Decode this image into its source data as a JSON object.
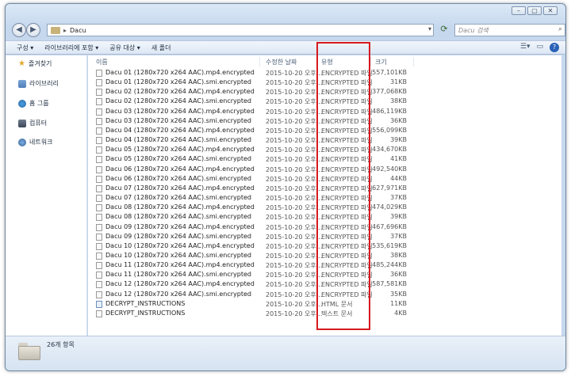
{
  "address": {
    "path": "Dacu"
  },
  "search": {
    "placeholder": "Dacu 검색"
  },
  "toolbar": {
    "items": [
      "구성 ▾",
      "라이브러리에 포함 ▾",
      "공유 대상 ▾",
      "새 폴더"
    ]
  },
  "navpane": {
    "items": [
      "즐겨찾기",
      "라이브러리",
      "홈 그룹",
      "컴퓨터",
      "네트워크"
    ]
  },
  "columns": {
    "name": "이름",
    "date": "수정한 날짜",
    "type": "유형",
    "size": "크기"
  },
  "files": [
    {
      "name": "Dacu 01 (1280x720 x264 AAC).mp4.encrypted",
      "date": "2015-10-20 오후...",
      "type": "ENCRYPTED 파일",
      "size": "557,101KB"
    },
    {
      "name": "Dacu 01 (1280x720 x264 AAC).smi.encrypted",
      "date": "2015-10-20 오후...",
      "type": "ENCRYPTED 파일",
      "size": "31KB"
    },
    {
      "name": "Dacu 02 (1280x720 x264 AAC).mp4.encrypted",
      "date": "2015-10-20 오후...",
      "type": "ENCRYPTED 파일",
      "size": "377,068KB"
    },
    {
      "name": "Dacu 02 (1280x720 x264 AAC).smi.encrypted",
      "date": "2015-10-20 오후...",
      "type": "ENCRYPTED 파일",
      "size": "38KB"
    },
    {
      "name": "Dacu 03 (1280x720 x264 AAC).mp4.encrypted",
      "date": "2015-10-20 오후...",
      "type": "ENCRYPTED 파일",
      "size": "486,119KB"
    },
    {
      "name": "Dacu 03 (1280x720 x264 AAC).smi.encrypted",
      "date": "2015-10-20 오후...",
      "type": "ENCRYPTED 파일",
      "size": "36KB"
    },
    {
      "name": "Dacu 04 (1280x720 x264 AAC).mp4.encrypted",
      "date": "2015-10-20 오후...",
      "type": "ENCRYPTED 파일",
      "size": "556,099KB"
    },
    {
      "name": "Dacu 04 (1280x720 x264 AAC).smi.encrypted",
      "date": "2015-10-20 오후...",
      "type": "ENCRYPTED 파일",
      "size": "39KB"
    },
    {
      "name": "Dacu 05 (1280x720 x264 AAC).mp4.encrypted",
      "date": "2015-10-20 오후...",
      "type": "ENCRYPTED 파일",
      "size": "434,670KB"
    },
    {
      "name": "Dacu 05 (1280x720 x264 AAC).smi.encrypted",
      "date": "2015-10-20 오후...",
      "type": "ENCRYPTED 파일",
      "size": "41KB"
    },
    {
      "name": "Dacu 06 (1280x720 x264 AAC).mp4.encrypted",
      "date": "2015-10-20 오후...",
      "type": "ENCRYPTED 파일",
      "size": "492,540KB"
    },
    {
      "name": "Dacu 06 (1280x720 x264 AAC).smi.encrypted",
      "date": "2015-10-20 오후...",
      "type": "ENCRYPTED 파일",
      "size": "44KB"
    },
    {
      "name": "Dacu 07 (1280x720 x264 AAC).mp4.encrypted",
      "date": "2015-10-20 오후...",
      "type": "ENCRYPTED 파일",
      "size": "627,971KB"
    },
    {
      "name": "Dacu 07 (1280x720 x264 AAC).smi.encrypted",
      "date": "2015-10-20 오후...",
      "type": "ENCRYPTED 파일",
      "size": "37KB"
    },
    {
      "name": "Dacu 08 (1280x720 x264 AAC).mp4.encrypted",
      "date": "2015-10-20 오후...",
      "type": "ENCRYPTED 파일",
      "size": "474,029KB"
    },
    {
      "name": "Dacu 08 (1280x720 x264 AAC).smi.encrypted",
      "date": "2015-10-20 오후...",
      "type": "ENCRYPTED 파일",
      "size": "39KB"
    },
    {
      "name": "Dacu 09 (1280x720 x264 AAC).mp4.encrypted",
      "date": "2015-10-20 오후...",
      "type": "ENCRYPTED 파일",
      "size": "467,696KB"
    },
    {
      "name": "Dacu 09 (1280x720 x264 AAC).smi.encrypted",
      "date": "2015-10-20 오후...",
      "type": "ENCRYPTED 파일",
      "size": "37KB"
    },
    {
      "name": "Dacu 10 (1280x720 x264 AAC).mp4.encrypted",
      "date": "2015-10-20 오후...",
      "type": "ENCRYPTED 파일",
      "size": "535,619KB"
    },
    {
      "name": "Dacu 10 (1280x720 x264 AAC).smi.encrypted",
      "date": "2015-10-20 오후...",
      "type": "ENCRYPTED 파일",
      "size": "38KB"
    },
    {
      "name": "Dacu 11 (1280x720 x264 AAC).mp4.encrypted",
      "date": "2015-10-20 오후...",
      "type": "ENCRYPTED 파일",
      "size": "485,244KB"
    },
    {
      "name": "Dacu 11 (1280x720 x264 AAC).smi.encrypted",
      "date": "2015-10-20 오후...",
      "type": "ENCRYPTED 파일",
      "size": "36KB"
    },
    {
      "name": "Dacu 12 (1280x720 x264 AAC).mp4.encrypted",
      "date": "2015-10-20 오후...",
      "type": "ENCRYPTED 파일",
      "size": "587,581KB"
    },
    {
      "name": "Dacu 12 (1280x720 x264 AAC).smi.encrypted",
      "date": "2015-10-20 오후...",
      "type": "ENCRYPTED 파일",
      "size": "35KB"
    },
    {
      "name": "DECRYPT_INSTRUCTIONS",
      "date": "2015-10-20 오후...",
      "type": "HTML 문서",
      "size": "11KB",
      "icon": "html-file-icon"
    },
    {
      "name": "DECRYPT_INSTRUCTIONS",
      "date": "2015-10-20 오후...",
      "type": "텍스트 문서",
      "size": "4KB"
    }
  ],
  "status": {
    "count": "26개 항목"
  },
  "highlight_color": "#d71920"
}
